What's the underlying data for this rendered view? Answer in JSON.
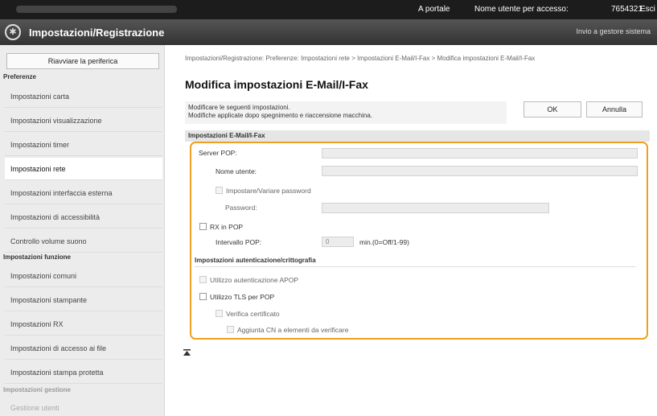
{
  "topbar": {
    "portal_link": "A portale",
    "user_label": "Nome utente per accesso:",
    "user_id": "7654321",
    "logout": "Esci"
  },
  "titlebar": {
    "app_title": "Impostazioni/Registrazione",
    "admin_link": "Invio a gestore sistema"
  },
  "sidebar": {
    "restart_label": "Riavviare la periferica",
    "sections": [
      {
        "title": "Preferenze",
        "items": [
          "Impostazioni carta",
          "Impostazioni visualizzazione",
          "Impostazioni timer",
          "Impostazioni rete",
          "Impostazioni interfaccia esterna",
          "Impostazioni di accessibilità",
          "Controllo volume suono"
        ]
      },
      {
        "title": "Impostazioni funzione",
        "items": [
          "Impostazioni comuni",
          "Impostazioni stampante",
          "Impostazioni RX",
          "Impostazioni di accesso ai file",
          "Impostazioni stampa protetta"
        ]
      },
      {
        "title": "Impostazioni gestione",
        "items": [
          "Gestione utenti"
        ]
      }
    ],
    "active_item": "Impostazioni rete"
  },
  "main": {
    "breadcrumb": "Impostazioni/Registrazione: Preferenze: Impostazioni rete > Impostazioni E-Mail/I-Fax > Modifica impostazioni E-Mail/I-Fax",
    "title": "Modifica impostazioni E-Mail/I-Fax",
    "intro_line1": "Modificare le seguenti impostazioni.",
    "intro_line2": "Modifiche applicate dopo spegnimento e riaccensione macchina.",
    "ok_label": "OK",
    "cancel_label": "Annulla",
    "section_title": "Impostazioni E-Mail/I-Fax",
    "server_pop_label": "Server POP:",
    "server_pop_value": "",
    "username_label": "Nome utente:",
    "username_value": "",
    "set_password_label": "Impostare/Variare password",
    "password_label": "Password:",
    "password_value": "",
    "rx_pop_label": "RX in POP",
    "pop_interval_label": "Intervallo POP:",
    "pop_interval_value": "0",
    "pop_interval_unit": "min.(0=Off/1-99)",
    "auth_section_title": "Impostazioni autenticazione/crittografia",
    "use_apop_label": "Utilizzo autenticazione APOP",
    "use_tls_label": "Utilizzo TLS per POP",
    "verify_cert_label": "Verifica certificato",
    "add_cn_label": "Aggiunta CN a elementi da verificare"
  },
  "colors": {
    "highlight": "#f0a020",
    "topbar": "#1c1c1c"
  }
}
